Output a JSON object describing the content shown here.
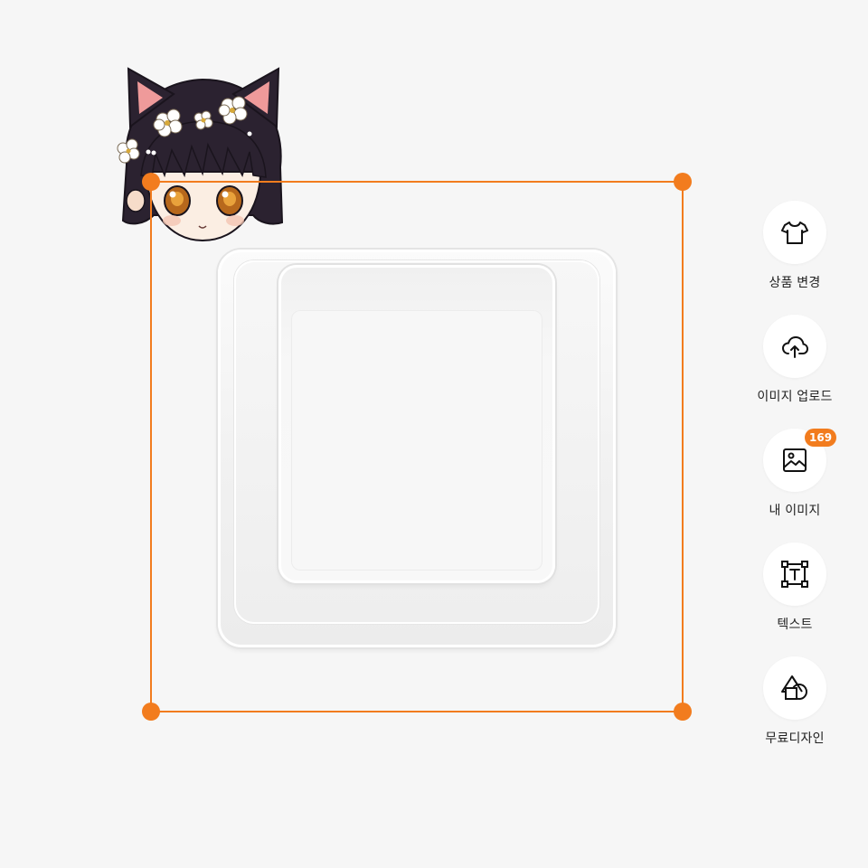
{
  "colors": {
    "accent": "#f27c1e",
    "background": "#f6f6f6",
    "tool_background": "#ffffff",
    "text": "#222222"
  },
  "canvas": {
    "product": "transparent-keycap",
    "image": "chibi-cat-girl-sticker"
  },
  "toolbar": {
    "items": [
      {
        "icon": "tshirt-icon",
        "label": "상품 변경"
      },
      {
        "icon": "cloud-upload-icon",
        "label": "이미지 업로드"
      },
      {
        "icon": "image-icon",
        "label": "내 이미지",
        "badge": "169"
      },
      {
        "icon": "text-box-icon",
        "label": "텍스트"
      },
      {
        "icon": "shapes-icon",
        "label": "무료디자인"
      }
    ]
  }
}
